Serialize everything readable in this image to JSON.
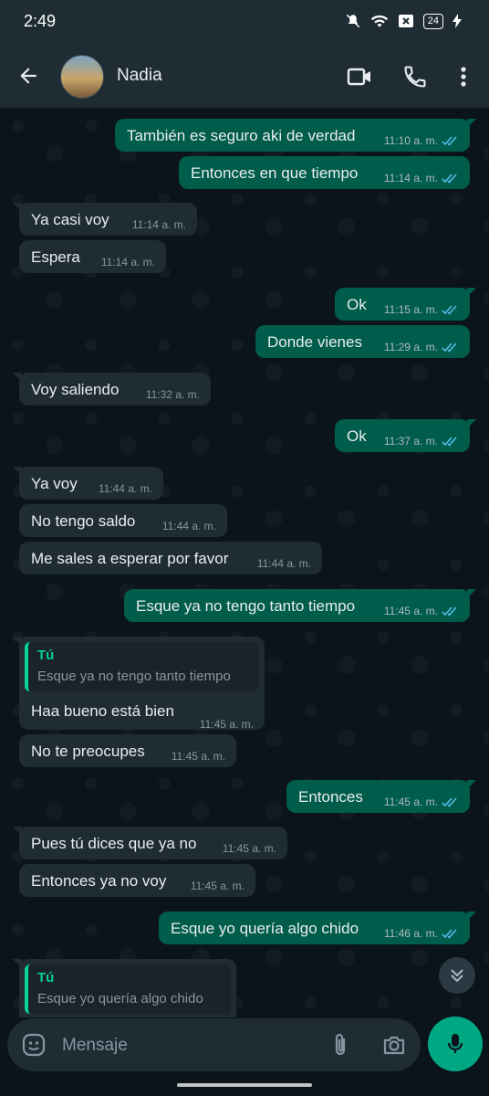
{
  "status_bar": {
    "time": "2:49",
    "battery": "24"
  },
  "header": {
    "contact_name": "Nadia"
  },
  "messages": [
    {
      "dir": "out",
      "text": "También es seguro aki de verdad",
      "time": "11:10 a. m."
    },
    {
      "dir": "out",
      "text": "Entonces en que tiempo",
      "time": "11:14 a. m."
    },
    {
      "dir": "in",
      "text": "Ya casi voy",
      "time": "11:14 a. m."
    },
    {
      "dir": "in",
      "text": "Espera",
      "time": "11:14 a. m."
    },
    {
      "dir": "out",
      "text": "Ok",
      "time": "11:15 a. m."
    },
    {
      "dir": "out",
      "text": "Donde vienes",
      "time": "11:29 a. m."
    },
    {
      "dir": "in",
      "text": "Voy saliendo",
      "time": "11:32 a. m."
    },
    {
      "dir": "out",
      "text": "Ok",
      "time": "11:37 a. m."
    },
    {
      "dir": "in",
      "text": "Ya voy",
      "time": "11:44 a. m."
    },
    {
      "dir": "in",
      "text": "No tengo saldo",
      "time": "11:44 a. m."
    },
    {
      "dir": "in",
      "text": "Me sales a esperar por favor",
      "time": "11:44 a. m."
    },
    {
      "dir": "out",
      "text": "Esque ya no tengo tanto tiempo",
      "time": "11:45 a. m."
    },
    {
      "dir": "in",
      "text": "Haa bueno está bien",
      "time": "11:45 a. m.",
      "reply_author": "Tú",
      "reply_text": "Esque ya no tengo tanto tiempo"
    },
    {
      "dir": "in",
      "text": "No te preocupes",
      "time": "11:45 a. m."
    },
    {
      "dir": "out",
      "text": "Entonces",
      "time": "11:45 a. m."
    },
    {
      "dir": "in",
      "text": "Pues tú dices que ya no",
      "time": "11:45 a. m."
    },
    {
      "dir": "in",
      "text": "Entonces ya no voy",
      "time": "11:45 a. m."
    },
    {
      "dir": "out",
      "text": "Esque yo quería algo chido",
      "time": "11:46 a. m."
    },
    {
      "dir": "in",
      "text": "",
      "time": "",
      "reply_author": "Tú",
      "reply_text": "Esque yo quería algo chido"
    }
  ],
  "composer": {
    "placeholder": "Mensaje"
  },
  "colors": {
    "outgoing": "#005c4b",
    "incoming": "#202c33",
    "accent": "#00a884",
    "read_ticks": "#53bdeb"
  },
  "icons": [
    "back-arrow-icon",
    "video-call-icon",
    "phone-icon",
    "more-vert-icon",
    "sticker-icon",
    "attach-icon",
    "camera-icon",
    "mic-icon",
    "scroll-down-icon"
  ]
}
